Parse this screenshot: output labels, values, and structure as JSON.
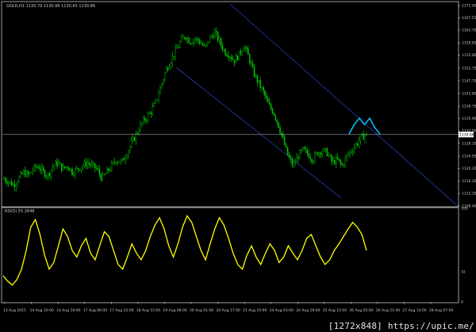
{
  "symbol_header": "GOLD,H1 1130.79 1130.96 1130.65 1130.86",
  "rsi_header": "RSI(5) 55.2648",
  "watermark": "[1272x848] https://upic.me/",
  "price_label": "1130.86",
  "colors": {
    "background": "#000000",
    "candles": "#00c800",
    "rsi": "#ffff00",
    "forecast": "#00bfff",
    "channel": "#1f3fb0",
    "axes": "#c8c8c8"
  },
  "chart_data": [
    {
      "type": "candlestick",
      "title": "GOLD,H1 1130.79 1130.96 1130.65 1130.86",
      "ylim": [
        1108.4,
        1172.4
      ],
      "y_ticks": [
        "1171.40",
        "1167.55",
        "1163.70",
        "1159.65",
        "1155.80",
        "1151.75",
        "1147.75",
        "1143.80",
        "1139.75",
        "1135.90",
        "1132.00",
        "1128.10",
        "1124.05",
        "1120.20",
        "1116.20",
        "1112.35",
        "1108.40"
      ],
      "x_ticks": [
        "13 Aug 2015",
        "14 Aug 10:00",
        "14 Aug 18:00",
        "17 Aug 06:00",
        "17 Aug 22:00",
        "18 Aug 15:00",
        "19 Aug 08:00",
        "20 Aug 01:00",
        "20 Aug 17:00",
        "21 Aug 10:00",
        "24 Aug 03:00",
        "24 Aug 19:00",
        "25 Aug 12:00",
        "26 Aug 05:00",
        "26 Aug 21:00",
        "27 Aug 14:00",
        "28 Aug 07:00"
      ],
      "close_path": [
        1117,
        1116,
        1115,
        1117,
        1119,
        1118,
        1120,
        1121,
        1119,
        1118,
        1121,
        1122,
        1120,
        1121,
        1119,
        1120,
        1121,
        1122,
        1121,
        1120,
        1117,
        1119,
        1121,
        1123,
        1122,
        1125,
        1128,
        1131,
        1134,
        1136,
        1138,
        1141,
        1146,
        1151,
        1154,
        1157,
        1160,
        1162,
        1160,
        1161,
        1160,
        1158,
        1161,
        1163,
        1160,
        1157,
        1156,
        1154,
        1156,
        1159,
        1155,
        1150,
        1147,
        1144,
        1140,
        1138,
        1134,
        1129,
        1124,
        1121,
        1124,
        1126,
        1125,
        1123,
        1125,
        1126,
        1125,
        1122,
        1123,
        1121,
        1124,
        1126,
        1128,
        1130,
        1131
      ],
      "last_price": 1130.86,
      "channel_lines": [
        [
          1172.4,
          1108.4
        ],
        [
          1154.0,
          1090.0
        ]
      ],
      "forecast_path": [
        1131,
        1134,
        1136,
        1134,
        1136,
        1133,
        1131
      ]
    },
    {
      "type": "line",
      "title": "RSI(5) 55.2648",
      "ylim": [
        0,
        100
      ],
      "y_ticks": [
        "100",
        "32",
        "0"
      ],
      "values": [
        28,
        22,
        18,
        24,
        35,
        55,
        80,
        88,
        72,
        50,
        35,
        42,
        60,
        78,
        70,
        55,
        48,
        60,
        68,
        52,
        45,
        60,
        75,
        70,
        55,
        40,
        35,
        48,
        62,
        52,
        45,
        55,
        70,
        82,
        90,
        78,
        60,
        48,
        62,
        80,
        92,
        85,
        70,
        55,
        45,
        62,
        78,
        90,
        82,
        68,
        52,
        40,
        35,
        50,
        60,
        48,
        40,
        52,
        62,
        55,
        42,
        48,
        60,
        52,
        45,
        55,
        68,
        72,
        60,
        48,
        40,
        45,
        55,
        62,
        70,
        78,
        85,
        80,
        72,
        55
      ]
    }
  ]
}
